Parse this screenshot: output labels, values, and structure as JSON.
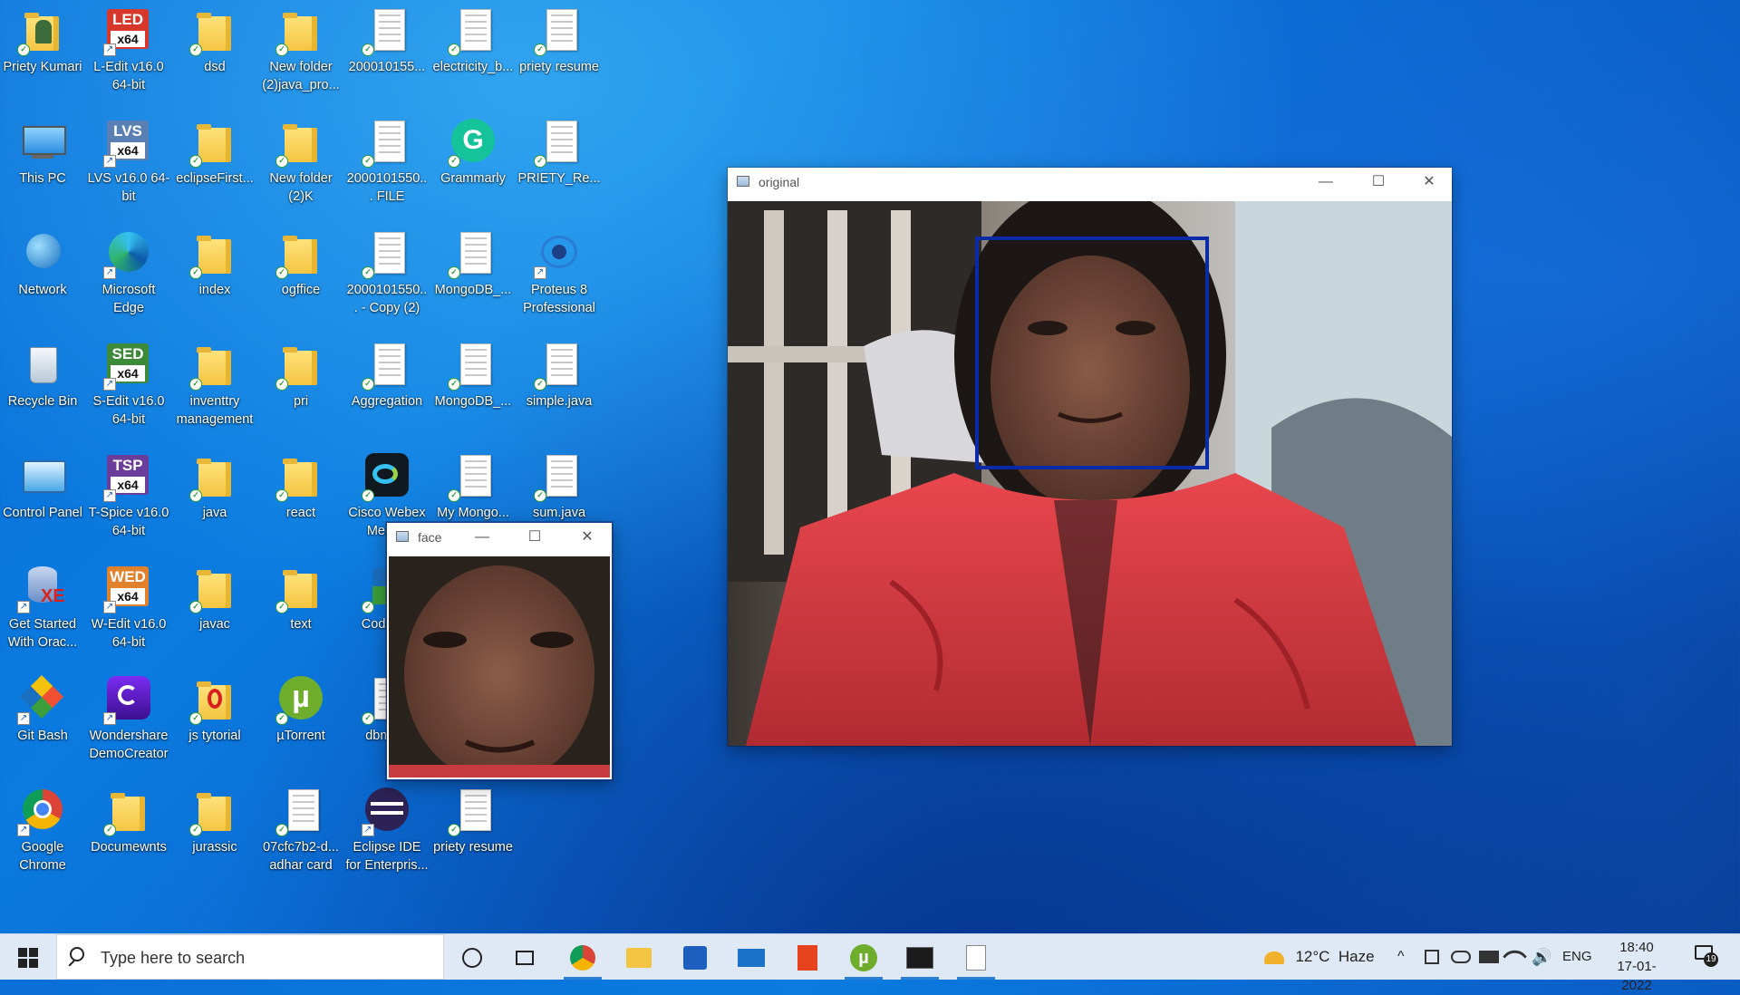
{
  "desktop_icons": [
    {
      "label": "Priety Kumari",
      "kind": "user-folder",
      "col": 0,
      "row": 0
    },
    {
      "label": "L-Edit v16.0 64-bit",
      "kind": "badge",
      "badge": "LED",
      "color": "#d8372b",
      "col": 1,
      "row": 0
    },
    {
      "label": "dsd",
      "kind": "folder",
      "col": 2,
      "row": 0
    },
    {
      "label": "New folder (2)java_pro...",
      "kind": "folder",
      "col": 3,
      "row": 0
    },
    {
      "label": "200010155...",
      "kind": "doc",
      "col": 4,
      "row": 0
    },
    {
      "label": "electricity_b...",
      "kind": "doc",
      "col": 5,
      "row": 0
    },
    {
      "label": "priety resume",
      "kind": "doc",
      "col": 6,
      "row": 0
    },
    {
      "label": "This PC",
      "kind": "pc",
      "col": 0,
      "row": 1
    },
    {
      "label": "LVS v16.0 64-bit",
      "kind": "badge",
      "badge": "LVS",
      "color": "#5a7fb3",
      "col": 1,
      "row": 1
    },
    {
      "label": "eclipseFirst...",
      "kind": "folder",
      "col": 2,
      "row": 1
    },
    {
      "label": "New folder (2)K",
      "kind": "folder",
      "col": 3,
      "row": 1
    },
    {
      "label": "2000101550... FILE",
      "kind": "doc",
      "col": 4,
      "row": 1
    },
    {
      "label": "Grammarly",
      "kind": "grammarly",
      "col": 5,
      "row": 1
    },
    {
      "label": "PRIETY_Re...",
      "kind": "doc",
      "col": 6,
      "row": 1
    },
    {
      "label": "Network",
      "kind": "network",
      "col": 0,
      "row": 2
    },
    {
      "label": "Microsoft Edge",
      "kind": "edge",
      "col": 1,
      "row": 2
    },
    {
      "label": "index",
      "kind": "folder",
      "col": 2,
      "row": 2
    },
    {
      "label": "ogffice",
      "kind": "folder",
      "col": 3,
      "row": 2
    },
    {
      "label": "2000101550... - Copy (2)",
      "kind": "doc",
      "col": 4,
      "row": 2
    },
    {
      "label": "MongoDB_...",
      "kind": "doc",
      "col": 5,
      "row": 2
    },
    {
      "label": "Proteus 8 Professional",
      "kind": "proteus",
      "col": 6,
      "row": 2
    },
    {
      "label": "Recycle Bin",
      "kind": "bin",
      "col": 0,
      "row": 3
    },
    {
      "label": "S-Edit v16.0 64-bit",
      "kind": "badge",
      "badge": "SED",
      "color": "#3d8a3a",
      "col": 1,
      "row": 3
    },
    {
      "label": "inventtry management",
      "kind": "folder",
      "col": 2,
      "row": 3
    },
    {
      "label": "pri",
      "kind": "folder",
      "col": 3,
      "row": 3
    },
    {
      "label": "Aggregation",
      "kind": "doc",
      "col": 4,
      "row": 3
    },
    {
      "label": "MongoDB_...",
      "kind": "doc",
      "col": 5,
      "row": 3
    },
    {
      "label": "simple.java",
      "kind": "doc",
      "col": 6,
      "row": 3
    },
    {
      "label": "Control Panel",
      "kind": "control",
      "col": 0,
      "row": 4
    },
    {
      "label": "T-Spice v16.0 64-bit",
      "kind": "badge",
      "badge": "TSP",
      "color": "#6a3d9a",
      "col": 1,
      "row": 4
    },
    {
      "label": "java",
      "kind": "folder",
      "col": 2,
      "row": 4
    },
    {
      "label": "react",
      "kind": "folder",
      "col": 3,
      "row": 4
    },
    {
      "label": "Cisco Webex Meet...",
      "kind": "webex",
      "col": 4,
      "row": 4
    },
    {
      "label": "My Mongo...",
      "kind": "doc",
      "col": 5,
      "row": 4
    },
    {
      "label": "sum.java",
      "kind": "doc",
      "col": 6,
      "row": 4
    },
    {
      "label": "Get Started With Orac...",
      "kind": "oracle",
      "col": 0,
      "row": 5
    },
    {
      "label": "W-Edit v16.0 64-bit",
      "kind": "badge",
      "badge": "WED",
      "color": "#e0822b",
      "col": 1,
      "row": 5
    },
    {
      "label": "javac",
      "kind": "folder",
      "col": 2,
      "row": 5
    },
    {
      "label": "text",
      "kind": "folder",
      "col": 3,
      "row": 5
    },
    {
      "label": "CodeB...",
      "kind": "codeblocks",
      "col": 4,
      "row": 5
    },
    {
      "label": "Git Bash",
      "kind": "git",
      "col": 0,
      "row": 6
    },
    {
      "label": "Wondershare DemoCreator",
      "kind": "demo",
      "col": 1,
      "row": 6
    },
    {
      "label": "js tytorial",
      "kind": "opera-folder",
      "col": 2,
      "row": 6
    },
    {
      "label": "µTorrent",
      "kind": "utorrent",
      "col": 3,
      "row": 6
    },
    {
      "label": "dbms...",
      "kind": "doc",
      "col": 4,
      "row": 6
    },
    {
      "label": "Google Chrome",
      "kind": "chrome",
      "col": 0,
      "row": 7
    },
    {
      "label": "Documewnts",
      "kind": "folder",
      "col": 1,
      "row": 7
    },
    {
      "label": "jurassic",
      "kind": "folder",
      "col": 2,
      "row": 7
    },
    {
      "label": "07cfc7b2-d... adhar card",
      "kind": "doc",
      "col": 3,
      "row": 7
    },
    {
      "label": "Eclipse IDE for Enterpris...",
      "kind": "eclipse",
      "col": 4,
      "row": 7
    },
    {
      "label": "priety resume",
      "kind": "doc",
      "col": 5,
      "row": 7
    }
  ],
  "windows": {
    "original": {
      "title": "original",
      "minimize": "—",
      "maximize": "☐",
      "close": "✕"
    },
    "face": {
      "title": "face",
      "minimize": "—",
      "maximize": "☐",
      "close": "✕"
    }
  },
  "taskbar": {
    "search_placeholder": "Type here to search",
    "apps": [
      {
        "name": "start-button",
        "icon": "windows-icon"
      },
      {
        "name": "cortana-button",
        "icon": "circle-icon"
      },
      {
        "name": "task-view-button",
        "icon": "task-view-icon"
      },
      {
        "name": "chrome-app",
        "icon": "chrome-icon",
        "active": true
      },
      {
        "name": "file-explorer-app",
        "icon": "folder-icon"
      },
      {
        "name": "store-app",
        "icon": "store-icon"
      },
      {
        "name": "mail-app",
        "icon": "mail-icon"
      },
      {
        "name": "office-app",
        "icon": "office-icon"
      },
      {
        "name": "utorrent-app",
        "icon": "utorrent-icon",
        "active": true
      },
      {
        "name": "terminal-app",
        "icon": "terminal-icon",
        "active": true
      },
      {
        "name": "blank-app",
        "icon": "page-icon",
        "active": true
      }
    ],
    "weather": "12°C  Haze",
    "language": "ENG",
    "time": "18:40",
    "date": "17-01-2022",
    "notifications": "19"
  },
  "colors": {
    "accent": "#0a6fd8",
    "face_box": "#0b2aa8",
    "jacket": "#d9393e"
  }
}
